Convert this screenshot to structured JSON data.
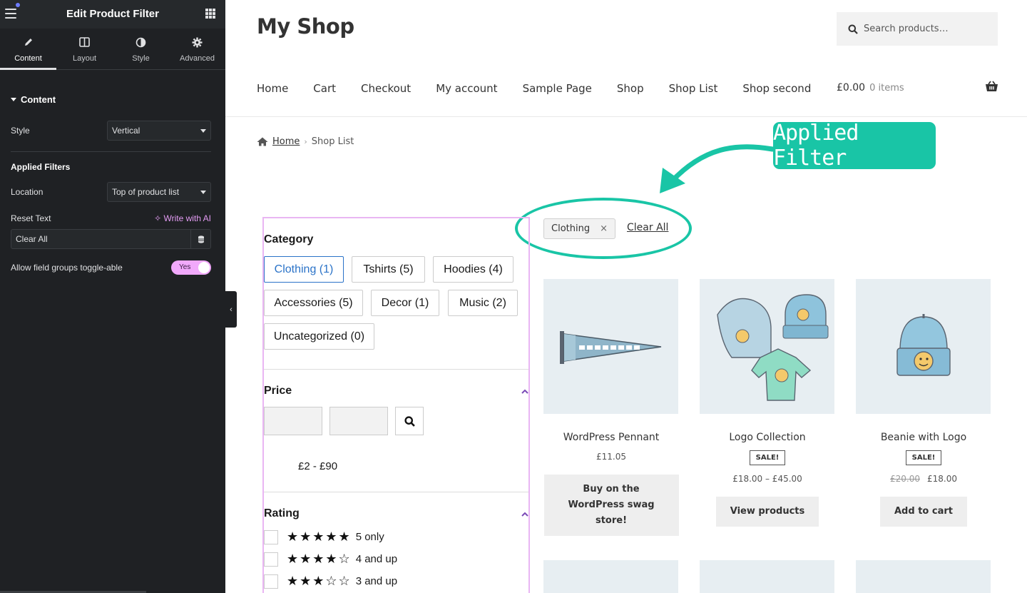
{
  "editor": {
    "title": "Edit Product Filter",
    "tabs": [
      {
        "label": "Content",
        "icon": "pencil-icon"
      },
      {
        "label": "Layout",
        "icon": "layout-icon"
      },
      {
        "label": "Style",
        "icon": "contrast-icon"
      },
      {
        "label": "Advanced",
        "icon": "gear-icon"
      }
    ],
    "section_title": "Content",
    "style_label": "Style",
    "style_value": "Vertical",
    "applied_filters_heading": "Applied Filters",
    "location_label": "Location",
    "location_value": "Top of product list",
    "reset_text_label": "Reset Text",
    "write_ai": "Write with AI",
    "reset_text_value": "Clear All",
    "toggle_label": "Allow field groups toggle-able",
    "toggle_value": "Yes",
    "colors": {
      "panel_bg": "#1f2124",
      "toggle": "#f1a9fb",
      "ai": "#e39bf3"
    }
  },
  "store": {
    "site_title": "My Shop",
    "search_placeholder": "Search products…",
    "nav": [
      "Home",
      "Cart",
      "Checkout",
      "My account",
      "Sample Page",
      "Shop",
      "Shop List",
      "Shop second"
    ],
    "cart_amount": "£0.00",
    "cart_items": "0 items",
    "breadcrumb": {
      "home": "Home",
      "current": "Shop List"
    },
    "callout": "Applied Filter",
    "applied_chip": "Clothing",
    "chip_remove": "×",
    "clear_all": "Clear All",
    "accent": "#19c5a6"
  },
  "filter": {
    "category_heading": "Category",
    "categories": [
      "Clothing (1)",
      "Tshirts (5)",
      "Hoodies (4)",
      "Accessories (5)",
      "Decor (1)",
      "Music (2)",
      "Uncategorized (0)"
    ],
    "price_heading": "Price",
    "price_range": "£2 - £90",
    "rating_heading": "Rating",
    "ratings": [
      {
        "stars": "★★★★★",
        "label": "5 only"
      },
      {
        "stars": "★★★★☆",
        "label": "4 and up"
      },
      {
        "stars": "★★★☆☆",
        "label": "3 and up"
      }
    ]
  },
  "products": [
    {
      "name": "WordPress Pennant",
      "price": "£11.05",
      "button": "Buy on the WordPress swag store!"
    },
    {
      "name": "Logo Collection",
      "sale": "SALE!",
      "price": "£18.00 – £45.00",
      "button": "View products"
    },
    {
      "name": "Beanie with Logo",
      "sale": "SALE!",
      "old_price": "£20.00",
      "price": "£18.00",
      "button": "Add to cart"
    }
  ]
}
